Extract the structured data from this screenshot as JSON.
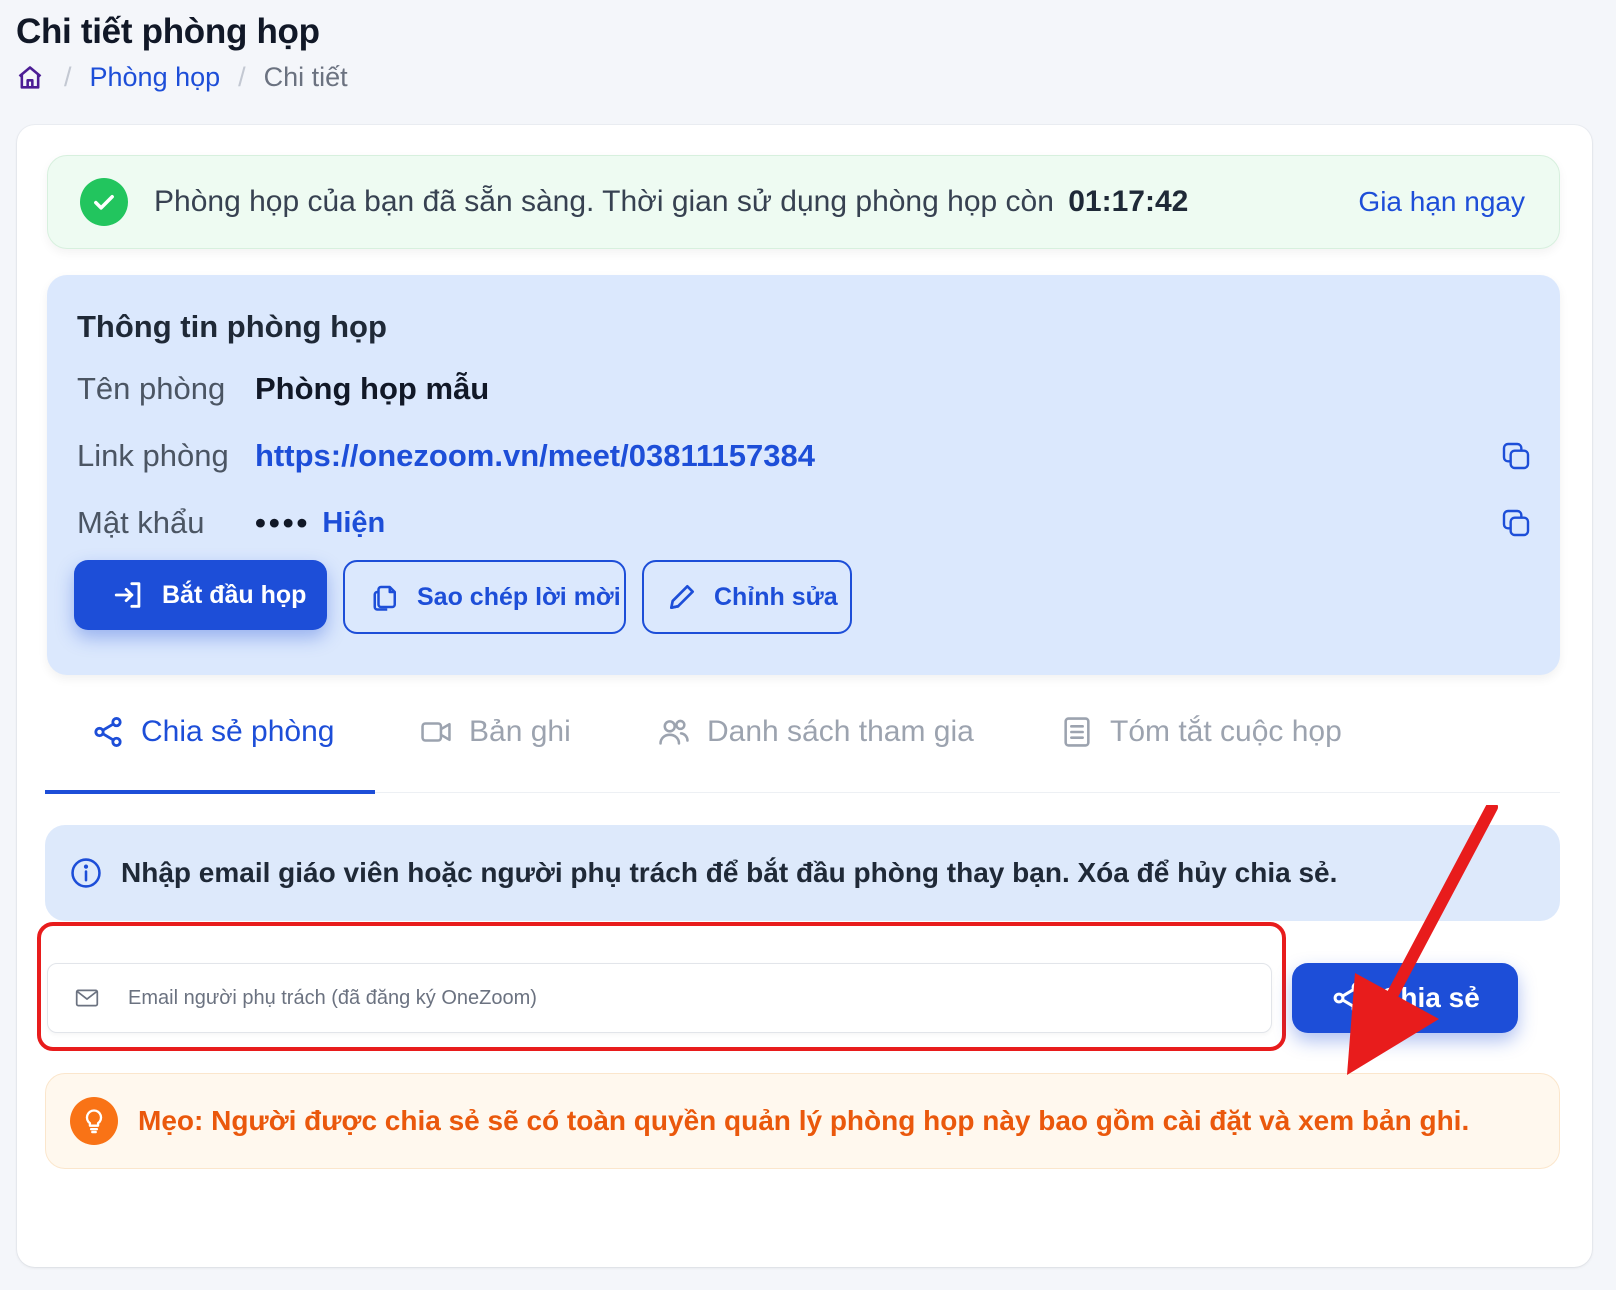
{
  "page": {
    "title": "Chi tiết phòng họp",
    "breadcrumb": {
      "separator": "/",
      "parent": "Phòng họp",
      "current": "Chi tiết"
    }
  },
  "status_alert": {
    "message": "Phòng họp của bạn đã sẵn sàng. Thời gian sử dụng phòng họp còn",
    "time_remaining": "01:17:42",
    "extend_link": "Gia hạn ngay"
  },
  "room_info": {
    "heading": "Thông tin phòng họp",
    "name_label": "Tên phòng",
    "name_value": "Phòng họp mẫu",
    "link_label": "Link phòng",
    "link_value": "https://onezoom.vn/meet/03811157384",
    "password_label": "Mật khẩu",
    "password_masked": "••••",
    "show_password": "Hiện",
    "buttons": {
      "start": "Bắt đầu họp",
      "copy_invite": "Sao chép lời mời",
      "edit": "Chỉnh sửa"
    }
  },
  "tabs": [
    {
      "label": "Chia sẻ phòng",
      "icon": "share-icon",
      "active": true
    },
    {
      "label": "Bản ghi",
      "icon": "video-icon",
      "active": false
    },
    {
      "label": "Danh sách tham gia",
      "icon": "users-icon",
      "active": false
    },
    {
      "label": "Tóm tắt cuộc họp",
      "icon": "document-icon",
      "active": false
    }
  ],
  "share_panel": {
    "notice": "Nhập email giáo viên hoặc người phụ trách để bắt đầu phòng thay bạn. Xóa để hủy chia sẻ.",
    "email_placeholder": "Email người phụ trách (đã đăng ký OneZoom)",
    "email_value": "",
    "share_button": "Chia sẻ",
    "tip": "Mẹo: Người được chia sẻ sẽ có toàn quyền quản lý phòng họp này bao gồm cài đặt và xem bản ghi."
  },
  "colors": {
    "accent": "#1d4ed8",
    "success": "#22c55e",
    "info_bg": "#dbe8fd",
    "tip_text": "#ea580c",
    "annotation_red": "#e81c1c"
  }
}
